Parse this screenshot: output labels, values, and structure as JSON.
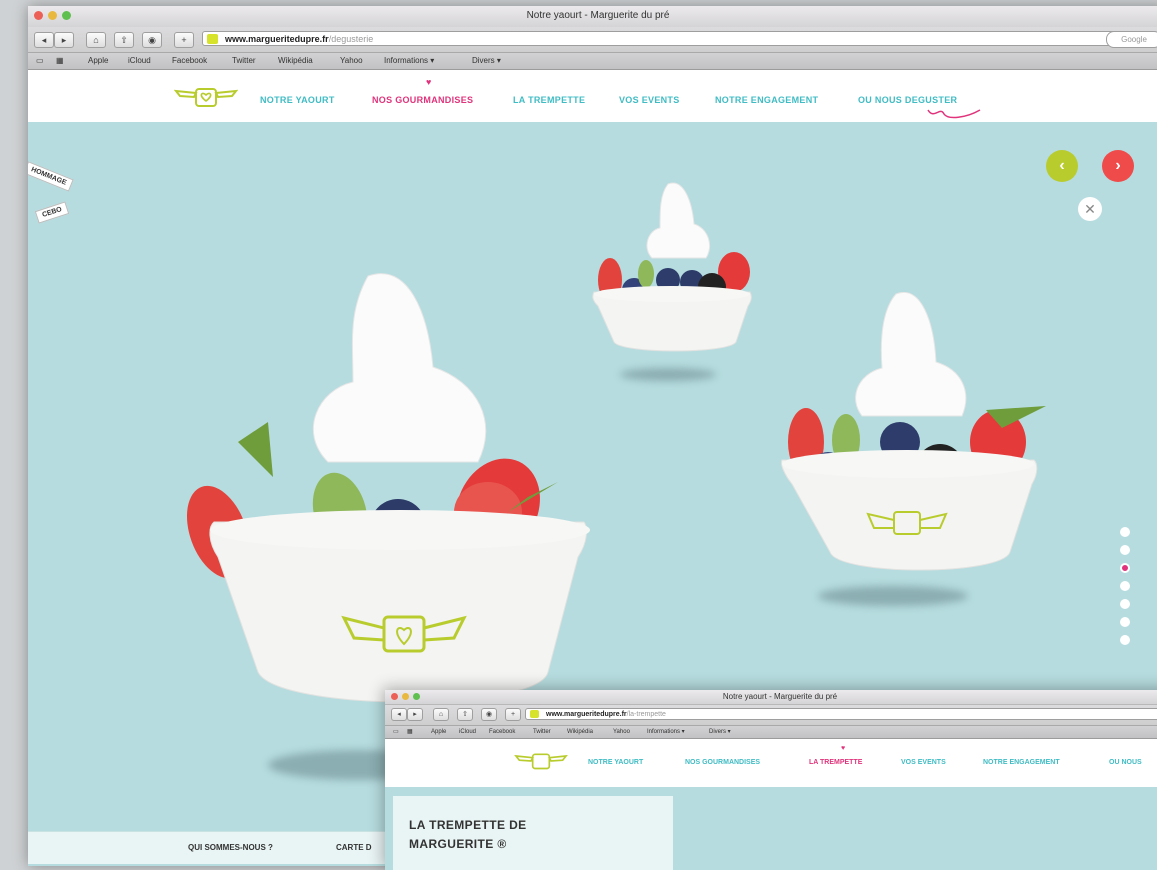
{
  "browser": {
    "window_title": "Notre yaourt - Marguerite du pré",
    "url_domain": "www.margueritedupre.fr",
    "url_path": "/degusterie",
    "search_placeholder": "Google",
    "nav_back": "◂",
    "nav_forward": "▸",
    "bookmarks": [
      "Apple",
      "iCloud",
      "Facebook",
      "Twitter",
      "Wikipédia",
      "Yahoo",
      "Informations ▾",
      "Divers ▾"
    ]
  },
  "site": {
    "nav": [
      {
        "label": "NOTRE YAOURT",
        "active": false
      },
      {
        "label": "NOS GOURMANDISES",
        "active": true
      },
      {
        "label": "LA TREMPETTE",
        "active": false
      },
      {
        "label": "VOS EVENTS",
        "active": false
      },
      {
        "label": "NOTRE ENGAGEMENT",
        "active": false
      },
      {
        "label": "OU NOUS DEGUSTER",
        "active": false
      }
    ],
    "side_tags": [
      "HOMMAGE",
      "CEBO"
    ],
    "slider": {
      "prev_glyph": "‹",
      "next_glyph": "›",
      "close_glyph": "✕",
      "dot_count": 7,
      "active_dot": 3
    },
    "footer": [
      "QUI SOMMES-NOUS ?",
      "CARTE D"
    ]
  },
  "inset": {
    "window_title": "Notre yaourt - Marguerite du pré",
    "url_domain": "www.margueritedupre.fr",
    "url_path": "/la-trempette",
    "bookmarks": [
      "Apple",
      "iCloud",
      "Facebook",
      "Twitter",
      "Wikipédia",
      "Yahoo",
      "Informations ▾",
      "Divers ▾"
    ],
    "nav": [
      {
        "label": "NOTRE YAOURT",
        "active": false
      },
      {
        "label": "NOS GOURMANDISES",
        "active": false
      },
      {
        "label": "LA TREMPETTE",
        "active": true
      },
      {
        "label": "VOS EVENTS",
        "active": false
      },
      {
        "label": "NOTRE ENGAGEMENT",
        "active": false
      },
      {
        "label": "OU NOUS",
        "active": false
      }
    ],
    "panel_title_1": "LA TREMPETTE DE",
    "panel_title_2": "MARGUERITE ®"
  },
  "colors": {
    "accent_pink": "#e0337b",
    "accent_teal": "#3fbcc4",
    "accent_lime": "#b9cc2e",
    "accent_red": "#f04b4b",
    "background": "#b6dcdf"
  }
}
